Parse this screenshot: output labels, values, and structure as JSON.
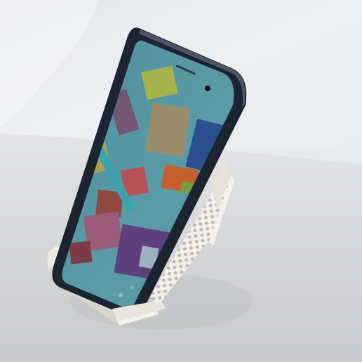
{
  "scene": {
    "subject": "phone-on-stand-photo",
    "colors": {
      "wall": "#eceef0",
      "table": "#d9dadc",
      "stand": "#f1efe7",
      "phone_frame": "#1b2430",
      "screen_bg": "#5a9aa6"
    },
    "wallpaper_tiles": [
      {
        "color": "#a7b34c"
      },
      {
        "color": "#9a8c6a"
      },
      {
        "color": "#2b4f8e"
      },
      {
        "color": "#c4602e"
      },
      {
        "color": "#b75159"
      },
      {
        "color": "#9b5c7a"
      },
      {
        "color": "#5d3f7e"
      },
      {
        "color": "#3aa4b0"
      },
      {
        "color": "#9fb0c0"
      }
    ]
  }
}
